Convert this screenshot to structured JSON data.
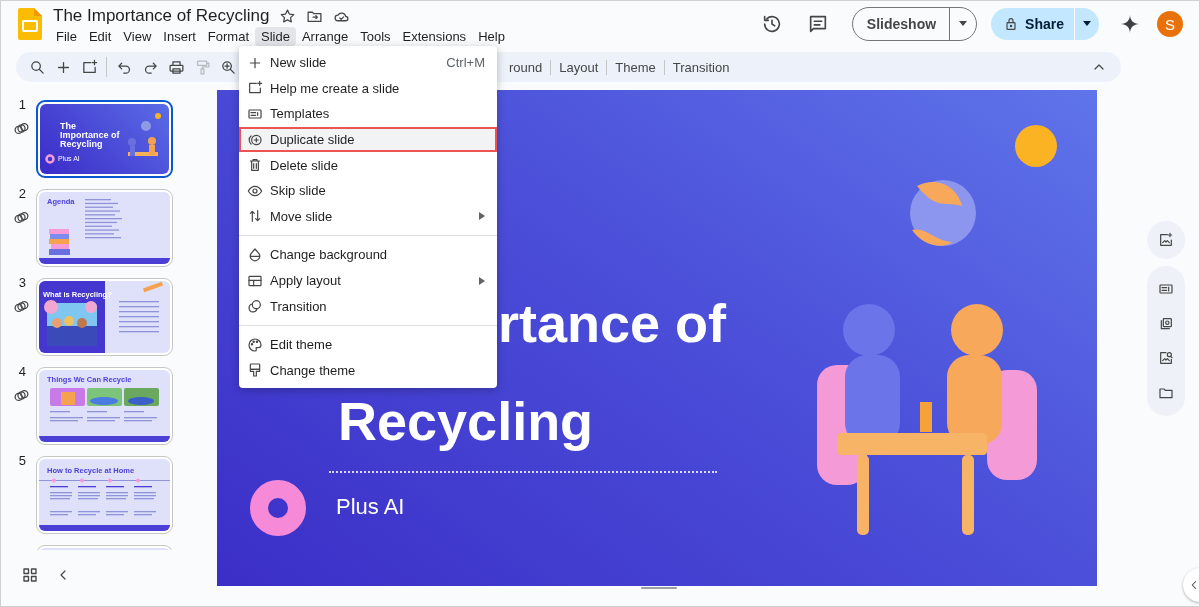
{
  "app": {
    "title": "The Importance of Recycling"
  },
  "menu_bar": [
    {
      "label": "File",
      "selected": false
    },
    {
      "label": "Edit",
      "selected": false
    },
    {
      "label": "View",
      "selected": false
    },
    {
      "label": "Insert",
      "selected": false
    },
    {
      "label": "Format",
      "selected": false
    },
    {
      "label": "Slide",
      "selected": true
    },
    {
      "label": "Arrange",
      "selected": false
    },
    {
      "label": "Tools",
      "selected": false
    },
    {
      "label": "Extensions",
      "selected": false
    },
    {
      "label": "Help",
      "selected": false
    }
  ],
  "header": {
    "slideshow": "Slideshow",
    "share": "Share",
    "avatar": "S"
  },
  "toolbar": {
    "tools": [
      {
        "kind": "search",
        "disabled": false
      },
      {
        "kind": "plus",
        "disabled": false
      },
      {
        "kind": "new-slide",
        "disabled": false
      },
      {
        "kind": "undo",
        "disabled": false
      },
      {
        "kind": "redo",
        "disabled": false
      },
      {
        "kind": "print",
        "disabled": false
      },
      {
        "kind": "paint-format",
        "disabled": true
      },
      {
        "kind": "zoom",
        "disabled": false
      }
    ],
    "buttons": [
      "round",
      "Layout",
      "Theme",
      "Transition"
    ]
  },
  "slides": [
    {
      "number": "1",
      "kind": "title",
      "selected": true,
      "linked": true,
      "title": "The Importance of Recycling",
      "subtitle": "Plus AI"
    },
    {
      "number": "2",
      "kind": "agenda",
      "selected": false,
      "linked": true,
      "title": "Agenda"
    },
    {
      "number": "3",
      "kind": "split",
      "selected": false,
      "linked": true,
      "title": "What is Recycling?"
    },
    {
      "number": "4",
      "kind": "gallery",
      "selected": false,
      "linked": true,
      "title": "Things We Can Recycle"
    },
    {
      "number": "5",
      "kind": "timeline",
      "selected": false,
      "linked": false,
      "title": "How to Recycle at Home"
    },
    {
      "kind": "cut",
      "selected": false,
      "linked": false
    }
  ],
  "slide": {
    "title_lines": [
      "rtance of",
      "Recycling"
    ],
    "subtitle": "Plus AI"
  },
  "slide_menu": [
    {
      "kind": "item",
      "label": "New slide",
      "shortcut": "Ctrl+M",
      "submenu": false,
      "selected": false
    },
    {
      "kind": "item",
      "label": "Help me create a slide",
      "submenu": false,
      "selected": false
    },
    {
      "kind": "item",
      "label": "Templates",
      "submenu": false,
      "selected": false
    },
    {
      "kind": "item",
      "label": "Duplicate slide",
      "submenu": false,
      "selected": true
    },
    {
      "kind": "item",
      "label": "Delete slide",
      "submenu": false,
      "selected": false
    },
    {
      "kind": "item",
      "label": "Skip slide",
      "submenu": false,
      "selected": false
    },
    {
      "kind": "item",
      "label": "Move slide",
      "submenu": true,
      "selected": false
    },
    {
      "kind": "separator"
    },
    {
      "kind": "item",
      "label": "Change background",
      "submenu": false,
      "selected": false
    },
    {
      "kind": "item",
      "label": "Apply layout",
      "submenu": true,
      "selected": false
    },
    {
      "kind": "item",
      "label": "Transition",
      "submenu": false,
      "selected": false
    },
    {
      "kind": "separator"
    },
    {
      "kind": "item",
      "label": "Edit theme",
      "submenu": false,
      "selected": false
    },
    {
      "kind": "item",
      "label": "Change theme",
      "submenu": false,
      "selected": false
    }
  ]
}
